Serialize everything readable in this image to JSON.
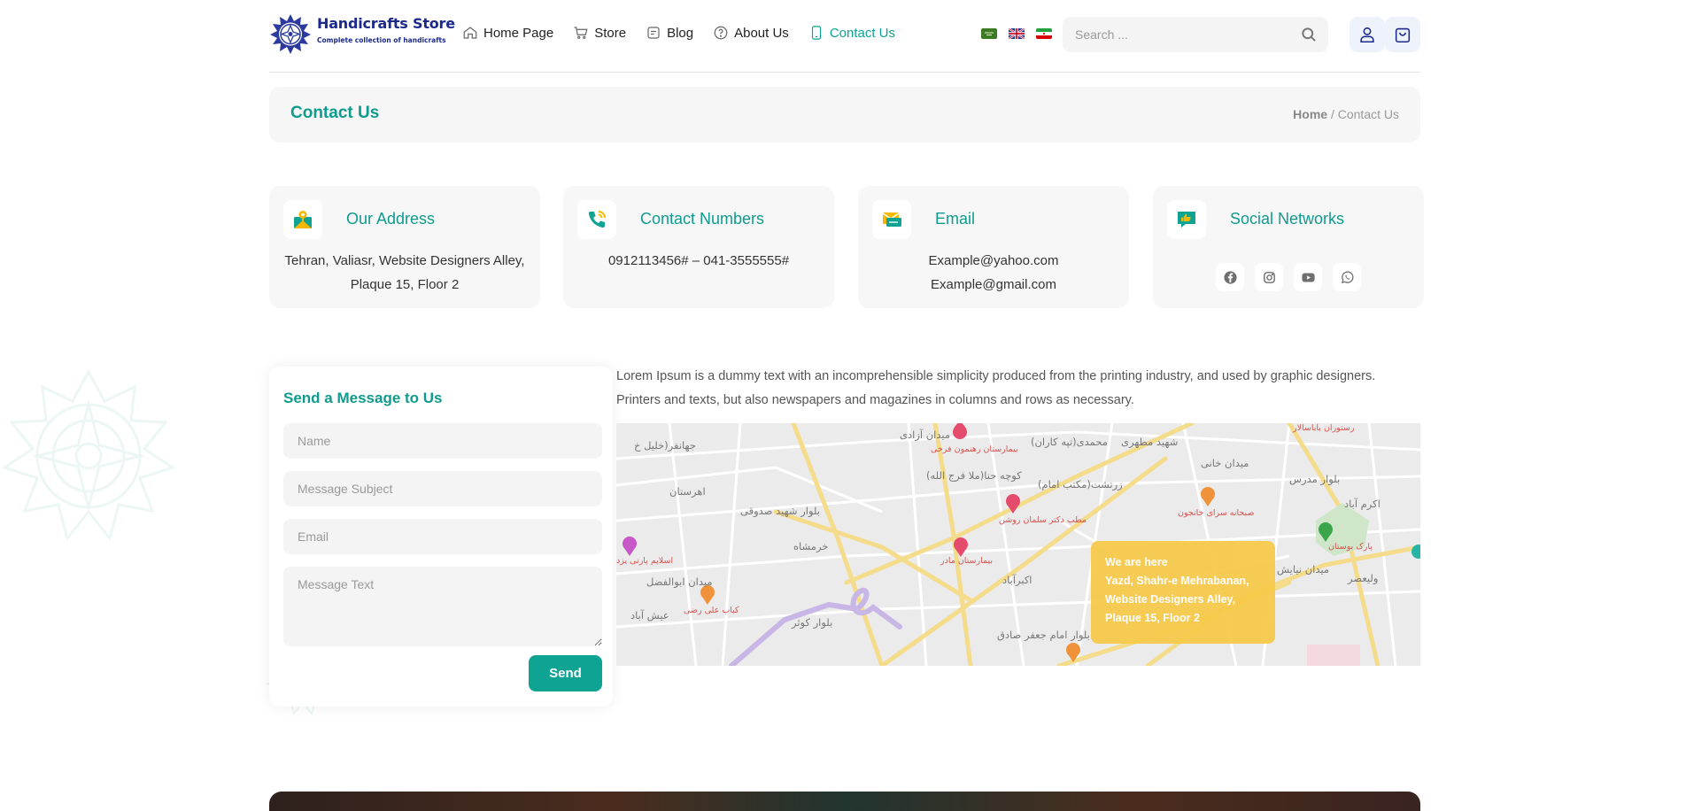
{
  "brand": {
    "title": "Handicrafts Store",
    "subtitle": "Complete collection of handicrafts",
    "color": "#1c2a8c"
  },
  "nav": [
    {
      "label": "Home Page",
      "icon": "home-icon",
      "active": false
    },
    {
      "label": "Store",
      "icon": "cart-icon",
      "active": false
    },
    {
      "label": "Blog",
      "icon": "blog-icon",
      "active": false
    },
    {
      "label": "About Us",
      "icon": "question-icon",
      "active": false
    },
    {
      "label": "Contact Us",
      "icon": "phone-icon",
      "active": true
    }
  ],
  "languages": [
    "flag-saudi-icon",
    "flag-uk-icon",
    "flag-iran-icon"
  ],
  "search": {
    "placeholder": "Search ..."
  },
  "page": {
    "title": "Contact Us",
    "breadcrumb": {
      "home": "Home",
      "separator": "/",
      "current": "Contact Us"
    }
  },
  "cards": {
    "address": {
      "title": "Our Address",
      "line1": "Tehran, Valiasr, Website Designers Alley,",
      "line2": "Plaque 15, Floor 2"
    },
    "phones": {
      "title": "Contact Numbers",
      "text": "0912113456# – 041-3555555#"
    },
    "email": {
      "title": "Email",
      "line1": "Example@yahoo.com",
      "line2": "Example@gmail.com"
    },
    "social": {
      "title": "Social Networks",
      "icons": [
        "facebook-icon",
        "instagram-icon",
        "youtube-icon",
        "whatsapp-icon"
      ]
    }
  },
  "form": {
    "title": "Send a Message to Us",
    "name_placeholder": "Name",
    "subject_placeholder": "Message Subject",
    "email_placeholder": "Email",
    "message_placeholder": "Message Text",
    "send_label": "Send"
  },
  "description": "Lorem Ipsum is a dummy text with an incomprehensible simplicity produced from the printing industry, and used by graphic designers. Printers and texts, but also newspapers and magazines in columns and rows as necessary.",
  "map": {
    "callout": {
      "heading": "We are here",
      "line1": "Yazd, Shahr-e Mehrabanan,",
      "line2": "Website Designers Alley,",
      "line3": "Plaque 15, Floor 2"
    },
    "labels": {
      "l1": "میدان آزادی",
      "l2": "بیمارستان رهنمون فرخی",
      "l3": "محمدی(تپه کاران)",
      "l4": "شهید مطهری",
      "l5": "میدان خانی",
      "l6": "بلوار مدرس",
      "l7": "اکرم آباد",
      "l8": "کوچه حنا(ملا فرج الله)",
      "l9": "زرتشت(مکتب امام)",
      "l10": "جهانفر(خلیل خ",
      "l11": "اهرستان",
      "l12": "بلوار شهید صدوقی",
      "l13": "خرمشاه",
      "l14": "بیمارستان مادر",
      "l15": "مطب دکتر سلمان روشن",
      "l16": "صبحانه سرای خانجون",
      "l17": "میدان نیایش",
      "l18": "ولیعصر",
      "l19": "میدان ابوالفضل",
      "l20": "کباب علی رضی",
      "l21": "عیش آباد",
      "l22": "بلوار کوثر",
      "l23": "اکبرآباد",
      "l24": "بلوار امام جعفر صادق",
      "l25": "اسلایم پارتی یزد",
      "l26": "پارک بوستان",
      "l27": "رستوران باباسالار"
    }
  },
  "colors": {
    "accent": "#0fa394",
    "callout": "#f7c948",
    "card_bg": "#f7f7f7"
  }
}
